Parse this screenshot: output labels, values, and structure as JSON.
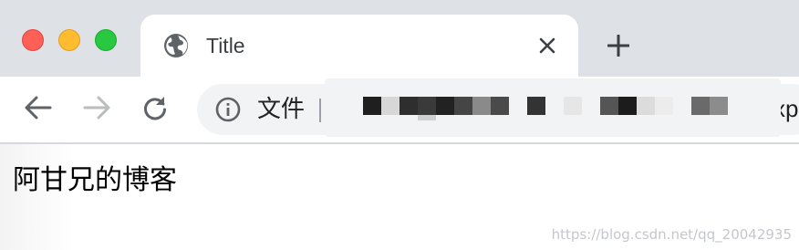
{
  "window": {
    "traffic_lights": {
      "close": "#fe5f57",
      "minimize": "#febc2e",
      "maximize": "#28c840"
    }
  },
  "tab": {
    "icon": "globe-icon",
    "title": "Title",
    "close_icon": "close-icon"
  },
  "new_tab_icon": "plus-icon",
  "toolbar": {
    "back_icon": "back-arrow-icon",
    "forward_icon": "forward-arrow-icon",
    "reload_icon": "reload-icon",
    "address_bar": {
      "info_icon": "info-icon",
      "scheme_label": "文件",
      "url_tail": "xp"
    }
  },
  "page": {
    "heading_text": "阿甘兄的博客"
  },
  "watermark": "https://blog.csdn.net/qq_20042935",
  "colors": {
    "tab_strip": "#dee1e6",
    "omnibox": "#f1f3f4",
    "icon": "#5f6368"
  }
}
